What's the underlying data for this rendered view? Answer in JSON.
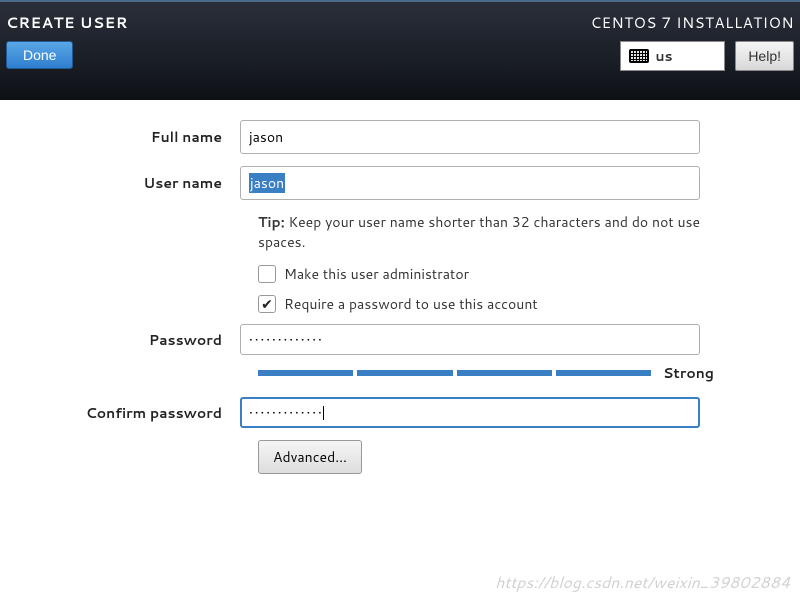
{
  "header": {
    "title_left": "CREATE USER",
    "done_label": "Done",
    "title_right": "CENTOS 7 INSTALLATION",
    "keyboard_layout": "us",
    "help_label": "Help!"
  },
  "form": {
    "full_name": {
      "label": "Full name",
      "value": "jason"
    },
    "user_name": {
      "label": "User name",
      "value": "jason"
    },
    "tip": {
      "prefix": "Tip:",
      "text": " Keep your user name shorter than 32 characters and do not use spaces."
    },
    "admin_checkbox": {
      "label": "Make this user administrator",
      "checked": false
    },
    "require_pw_checkbox": {
      "label": "Require a password to use this account",
      "checked": true
    },
    "password": {
      "label": "Password",
      "mask": "•••••••••••••"
    },
    "strength": {
      "level": 4,
      "label": "Strong"
    },
    "confirm_password": {
      "label": "Confirm password",
      "mask": "•••••••••••••"
    },
    "advanced_label": "Advanced..."
  },
  "watermark": "https://blog.csdn.net/weixin_39802884"
}
